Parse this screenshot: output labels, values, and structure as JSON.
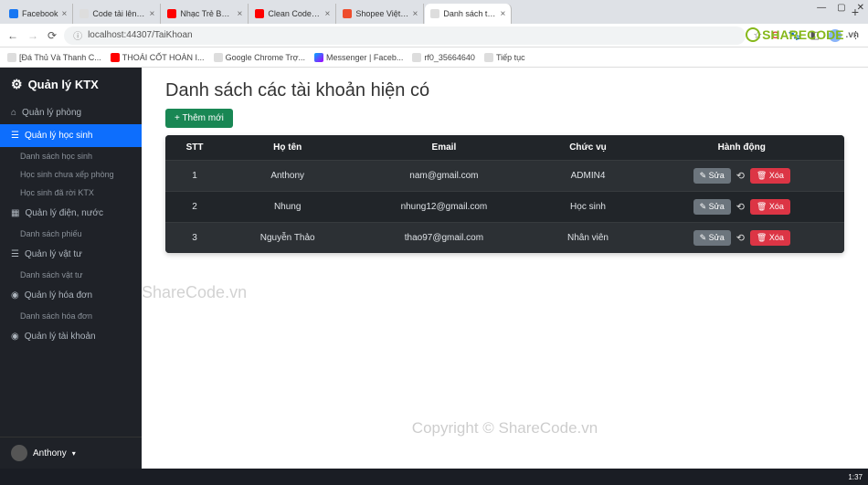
{
  "browser": {
    "tabs": [
      {
        "label": "Facebook",
        "favcls": "ico-fb"
      },
      {
        "label": "Code tải lên của tôi",
        "favcls": "ico-gn"
      },
      {
        "label": "Nhạc Trẻ Ballad Việt Hay N",
        "favcls": "ico-yt"
      },
      {
        "label": "Clean Code - YouTube",
        "favcls": "ico-yt"
      },
      {
        "label": "Shopee Việt Nam | Mua và Bán",
        "favcls": "ico-sh"
      },
      {
        "label": "Danh sách tài khoản",
        "favcls": "ico-gn",
        "active": true
      }
    ],
    "url": "localhost:44307/TaiKhoan",
    "bookmarks": [
      {
        "label": "[Đá Thủ Và Thanh C...",
        "favcls": "ico-gn"
      },
      {
        "label": "THOÁI CỐT HOÀN I...",
        "favcls": "ico-yt"
      },
      {
        "label": "Google Chrome Trợ...",
        "favcls": "ico-gn"
      },
      {
        "label": "Messenger | Faceb...",
        "favcls": "ico-ms"
      },
      {
        "label": "rf0_35664640",
        "favcls": "ico-gn"
      },
      {
        "label": "Tiếp tục",
        "favcls": "ico-gn"
      }
    ]
  },
  "sidebar": {
    "brand": "Quản lý KTX",
    "items": [
      {
        "icon": "⌂",
        "label": "Quản lý phòng"
      },
      {
        "icon": "☰",
        "label": "Quản lý học sinh",
        "active": true,
        "subs": [
          "Danh sách học sinh",
          "Học sinh chưa xếp phòng",
          "Học sinh đã rời KTX"
        ]
      },
      {
        "icon": "▦",
        "label": "Quản lý điện, nước",
        "subs": [
          "Danh sách phiếu"
        ]
      },
      {
        "icon": "☰",
        "label": "Quản lý vật tư",
        "subs": [
          "Danh sách vật tư"
        ]
      },
      {
        "icon": "◉",
        "label": "Quản lý hóa đơn",
        "subs": [
          "Danh sách hóa đơn"
        ]
      },
      {
        "icon": "◉",
        "label": "Quản lý tài khoản"
      }
    ],
    "user": "Anthony"
  },
  "page": {
    "title": "Danh sách các tài khoản hiện có",
    "add_label": "+ Thêm mới",
    "columns": {
      "stt": "STT",
      "name": "Họ tên",
      "email": "Email",
      "role": "Chức vụ",
      "actions": "Hành động"
    },
    "btn_edit": "Sửa",
    "btn_del": "Xóa",
    "rows": [
      {
        "stt": "1",
        "name": "Anthony",
        "email": "nam@gmail.com",
        "role": "ADMIN4"
      },
      {
        "stt": "2",
        "name": "Nhung",
        "email": "nhung12@gmail.com",
        "role": "Học sinh"
      },
      {
        "stt": "3",
        "name": "Nguyễn Thảo",
        "email": "thao97@gmail.com",
        "role": "Nhân viên"
      }
    ]
  },
  "watermark": {
    "logo": "SHARECODE",
    "tld": ".vn",
    "center": "ShareCode.vn",
    "bottom": "Copyright © ShareCode.vn"
  },
  "clock": "1:37"
}
